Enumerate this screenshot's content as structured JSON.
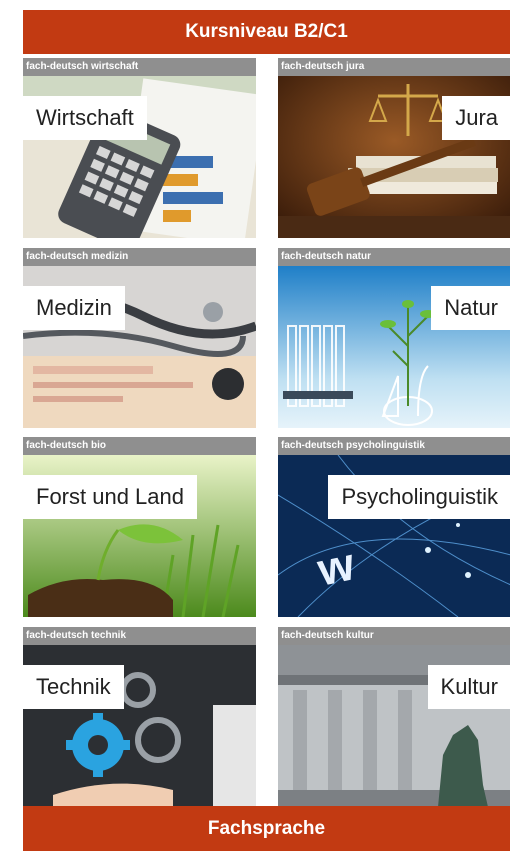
{
  "header": {
    "title": "Kursniveau B2/C1"
  },
  "footer": {
    "title": "Fachsprache"
  },
  "cards": [
    {
      "tag": "fach-deutsch wirtschaft",
      "label": "Wirtschaft"
    },
    {
      "tag": "fach-deutsch jura",
      "label": "Jura"
    },
    {
      "tag": "fach-deutsch medizin",
      "label": "Medizin"
    },
    {
      "tag": "fach-deutsch natur",
      "label": "Natur"
    },
    {
      "tag": "fach-deutsch bio",
      "label": "Forst und Land"
    },
    {
      "tag": "fach-deutsch psycholinguistik",
      "label": "Psycholinguistik"
    },
    {
      "tag": "fach-deutsch technik",
      "label": "Technik"
    },
    {
      "tag": "fach-deutsch kultur",
      "label": "Kultur"
    }
  ],
  "colors": {
    "brand": "#c23a12",
    "tag_bar": "#8f8f8f"
  }
}
